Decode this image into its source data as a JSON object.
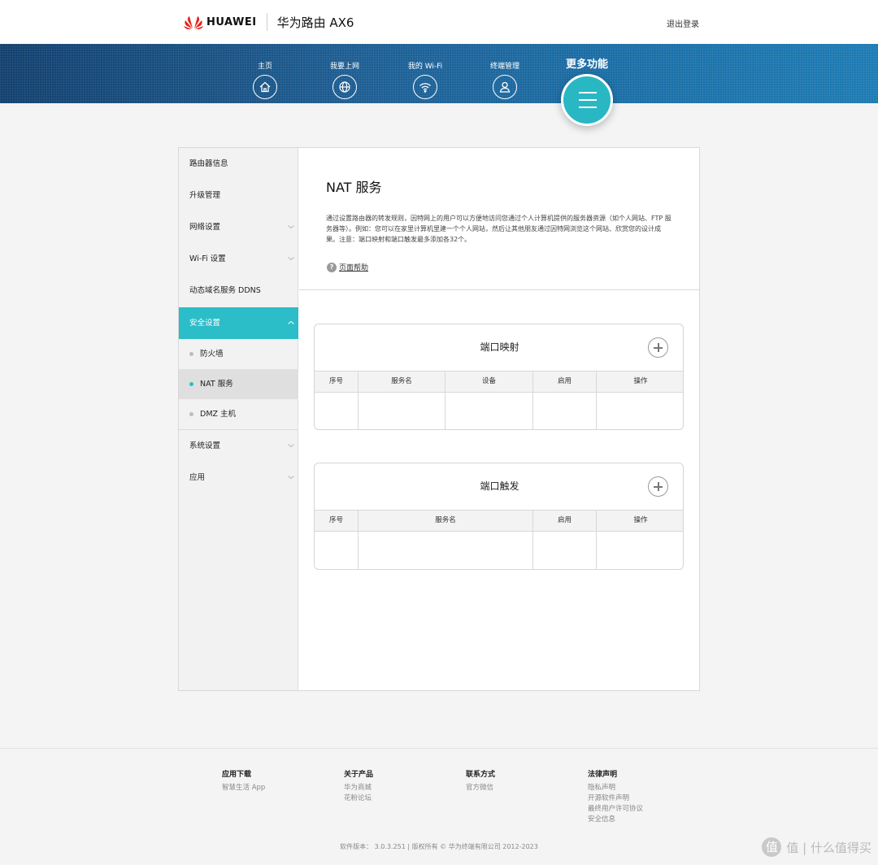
{
  "header": {
    "brand": "HUAWEI",
    "product": "华为路由 AX6",
    "logout": "退出登录"
  },
  "nav": {
    "items": [
      {
        "label": "主页",
        "icon": "home-icon"
      },
      {
        "label": "我要上网",
        "icon": "globe-icon"
      },
      {
        "label": "我的 Wi-Fi",
        "icon": "wifi-icon"
      },
      {
        "label": "终端管理",
        "icon": "user-icon"
      }
    ],
    "more": {
      "label": "更多功能",
      "icon": "menu-icon"
    }
  },
  "sidebar": {
    "items": [
      {
        "label": "路由器信息"
      },
      {
        "label": "升级管理"
      },
      {
        "label": "网络设置",
        "expand": "chevron-down"
      },
      {
        "label": "Wi-Fi 设置",
        "expand": "chevron-down"
      },
      {
        "label": "动态域名服务 DDNS"
      },
      {
        "label": "安全设置",
        "expand": "chevron-up",
        "active": true
      },
      {
        "label": "系统设置",
        "expand": "chevron-down"
      },
      {
        "label": "应用",
        "expand": "chevron-down"
      }
    ],
    "subitems": [
      {
        "label": "防火墙"
      },
      {
        "label": "NAT 服务",
        "selected": true
      },
      {
        "label": "DMZ 主机"
      }
    ]
  },
  "content": {
    "title": "NAT 服务",
    "description": "通过设置路由器的转发规则，因特网上的用户可以方便地访问您通过个人计算机提供的服务器资源（如个人网站、FTP 服务器等）。例如：您可以在家里计算机里建一个个人网站，然后让其他朋友通过因特网浏览这个网站、欣赏您的设计成果。注意：端口映射和端口触发最多添加各32个。",
    "help": "页面帮助",
    "port_mapping": {
      "title": "端口映射",
      "columns": [
        "序号",
        "服务名",
        "设备",
        "启用",
        "操作"
      ]
    },
    "port_trigger": {
      "title": "端口触发",
      "columns": [
        "序号",
        "服务名",
        "启用",
        "操作"
      ]
    }
  },
  "footer": {
    "columns": [
      {
        "heading": "应用下载",
        "links": [
          "智慧生活 App"
        ]
      },
      {
        "heading": "关于产品",
        "links": [
          "华为商城",
          "花粉论坛"
        ]
      },
      {
        "heading": "联系方式",
        "links": [
          "官方微信"
        ]
      },
      {
        "heading": "法律声明",
        "links": [
          "隐私声明",
          "开源软件声明",
          "最终用户许可协议",
          "安全信息"
        ]
      }
    ],
    "copyright": "软件版本： 3.0.3.251 | 版权所有 © 华为终端有限公司 2012-2023"
  },
  "watermark": {
    "text": "值 | 什么值得买",
    "icon_glyph": "值"
  },
  "colors": {
    "accent": "#2bbdc8",
    "nav_dark": "#12406e",
    "nav_light": "#1d7bb3",
    "brand_red": "#e1251b"
  }
}
